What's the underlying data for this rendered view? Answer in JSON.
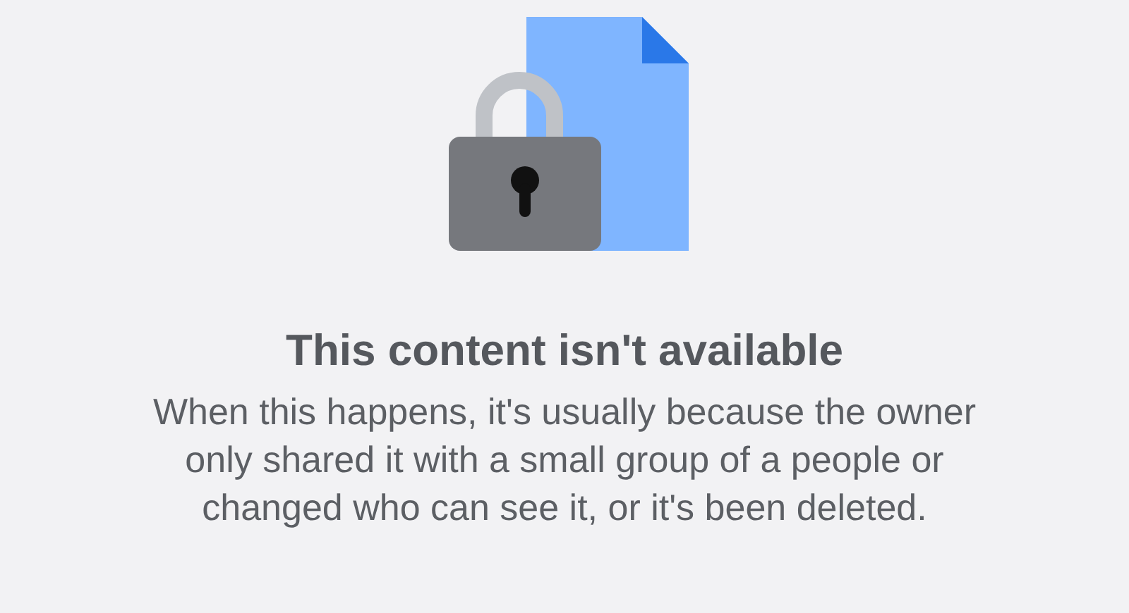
{
  "message": {
    "title": "This content isn't available",
    "body": "When this happens, it's usually because the owner only shared it with a small group of a people or changed who can see it, or it's been deleted."
  }
}
